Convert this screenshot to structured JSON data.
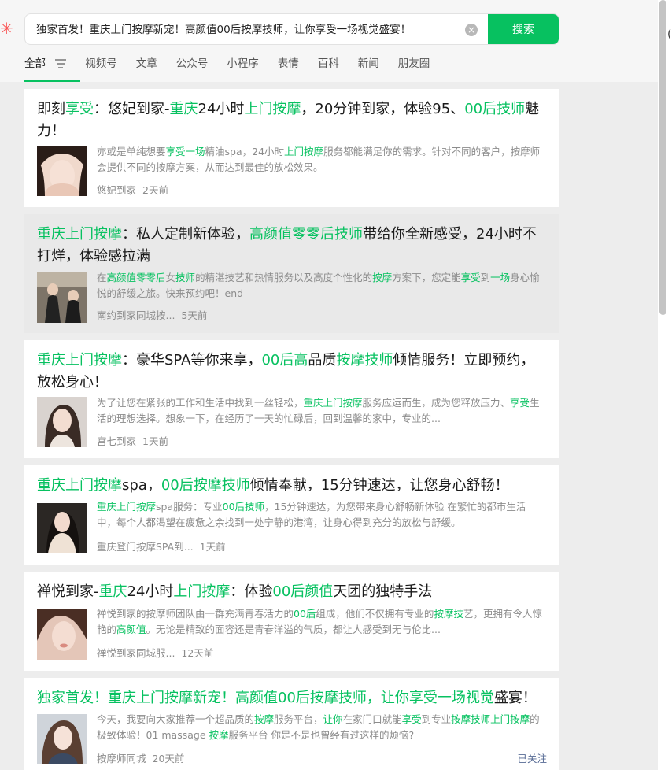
{
  "search": {
    "query": "独家首发！重庆上门按摩新宠！高颜值00后按摩技师，让你享受一场视觉盛宴！",
    "button_label": "搜索"
  },
  "tabs": [
    "全部",
    "视频号",
    "文章",
    "公众号",
    "小程序",
    "表情",
    "百科",
    "新闻",
    "朋友圈"
  ],
  "edge_char": "(",
  "colors": {
    "accent": "#07c160",
    "link": "#576b95",
    "meta": "#8c8c8c"
  },
  "results": [
    {
      "title_parts": [
        [
          "即刻",
          false
        ],
        [
          "享受",
          true
        ],
        [
          "：悠妃到家-",
          false
        ],
        [
          "重庆",
          true
        ],
        [
          "24小时",
          false
        ],
        [
          "上门按摩",
          true
        ],
        [
          "，20分钟到家，体验95、",
          false
        ],
        [
          "00后技师",
          true
        ],
        [
          "魅力！",
          false
        ]
      ],
      "desc_parts": [
        [
          "亦或是单纯想要",
          false
        ],
        [
          "享受一场",
          true
        ],
        [
          "精油spa，24小时",
          false
        ],
        [
          "上门按摩",
          true
        ],
        [
          "服务都能满足你的需求。针对不同的客户，按摩师会提供不同的按摩方案，从而达到最佳的放松效果。",
          false
        ]
      ],
      "source": "悠妃到家",
      "time": "2天前"
    },
    {
      "title_parts": [
        [
          "重庆上门按摩",
          true
        ],
        [
          "：私人定制新体验，",
          false
        ],
        [
          "高颜值零零后技师",
          true
        ],
        [
          "带给你全新感受，24小时不打烊，体验感拉满",
          false
        ]
      ],
      "desc_parts": [
        [
          "在",
          false
        ],
        [
          "高颜值零零后",
          true
        ],
        [
          "女",
          false
        ],
        [
          "技师",
          true
        ],
        [
          "的精湛技艺和热情服务以及高度个性化的",
          false
        ],
        [
          "按摩",
          true
        ],
        [
          "方案下，您定能",
          false
        ],
        [
          "享受",
          true
        ],
        [
          "到",
          false
        ],
        [
          "一场",
          true
        ],
        [
          "身心愉悦的舒缓之旅。快来预约吧！end",
          false
        ]
      ],
      "source": "南约到家同城按...",
      "time": "5天前"
    },
    {
      "title_parts": [
        [
          "重庆上门按摩",
          true
        ],
        [
          "：豪华SPA等你来享，",
          false
        ],
        [
          "00后高",
          true
        ],
        [
          "品质",
          false
        ],
        [
          "按摩技师",
          true
        ],
        [
          "倾情服务！立即预约，放松身心！",
          false
        ]
      ],
      "desc_parts": [
        [
          "为了让您在紧张的工作和生活中找到一丝轻松，",
          false
        ],
        [
          "重庆上门按摩",
          true
        ],
        [
          "服务应运而生，成为您释放压力、",
          false
        ],
        [
          "享受",
          true
        ],
        [
          "生活的理想选择。想象一下，在经历了一天的忙碌后，回到温馨的家中，专业的...",
          false
        ]
      ],
      "source": "宫七到家",
      "time": "1天前"
    },
    {
      "title_parts": [
        [
          "重庆上门按摩",
          true
        ],
        [
          "spa，",
          false
        ],
        [
          "00后按摩技师",
          true
        ],
        [
          "倾情奉献，15分钟速达，让您身心舒畅！",
          false
        ]
      ],
      "desc_parts": [
        [
          "重庆上门按摩",
          true
        ],
        [
          "spa服务：专业",
          false
        ],
        [
          "00后技师",
          true
        ],
        [
          "，15分钟速达，为您带来身心舒畅新体验 在繁忙的都市生活中，每个人都渴望在疲惫之余找到一处宁静的港湾，让身心得到充分的放松与舒缓。",
          false
        ]
      ],
      "source": "重庆登门按摩SPA到...",
      "time": "1天前"
    },
    {
      "title_parts": [
        [
          "禅悦到家-",
          false
        ],
        [
          "重庆",
          true
        ],
        [
          "24小时",
          false
        ],
        [
          "上门按摩",
          true
        ],
        [
          "：体验",
          false
        ],
        [
          "00后颜值",
          true
        ],
        [
          "天团的独特手法",
          false
        ]
      ],
      "desc_parts": [
        [
          "禅悦到家的按摩师团队由一群充满青春活力的",
          false
        ],
        [
          "00后",
          true
        ],
        [
          "组成，他们不仅拥有专业的",
          false
        ],
        [
          "按摩技",
          true
        ],
        [
          "艺，更拥有令人惊艳的",
          false
        ],
        [
          "高颜值",
          true
        ],
        [
          "。无论是精致的面容还是青春洋溢的气质，都让人感受到无与伦比...",
          false
        ]
      ],
      "source": "禅悦到家同城服...",
      "time": "12天前"
    },
    {
      "title_parts": [
        [
          "独家首发！重庆上门按摩新宠！高颜值00后按摩技师，让你享受一场视觉",
          true
        ],
        [
          "盛宴！",
          false
        ]
      ],
      "desc_parts": [
        [
          "今天，我要向大家推荐一个超品质的",
          false
        ],
        [
          "按摩",
          true
        ],
        [
          "服务平台，",
          false
        ],
        [
          "让你",
          true
        ],
        [
          "在家门口就能",
          false
        ],
        [
          "享受",
          true
        ],
        [
          "到专业",
          false
        ],
        [
          "按摩技师上门按摩",
          true
        ],
        [
          "的极致体验！01 massage ",
          false
        ],
        [
          "按摩",
          true
        ],
        [
          "服务平台 你是不是也曾经有过这样的烦恼?",
          false
        ]
      ],
      "source": "按摩师同城",
      "time": "20天前",
      "follow_label": "已关注"
    }
  ]
}
